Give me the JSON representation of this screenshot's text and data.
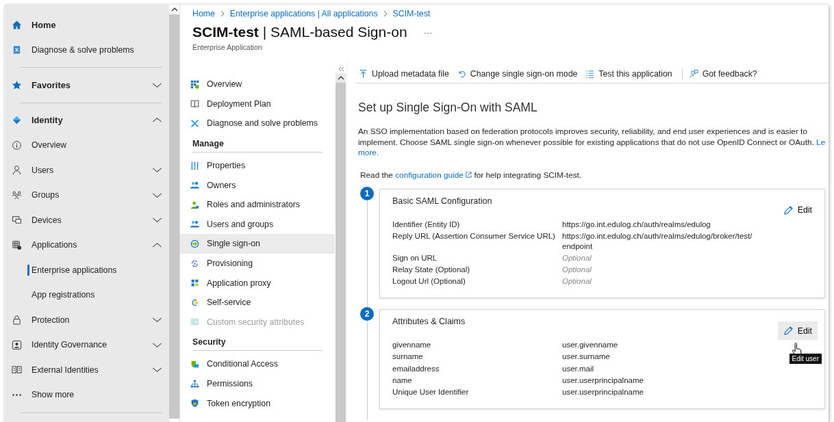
{
  "nav": {
    "groups": [
      {
        "items": [
          {
            "label": "Home",
            "kind": "heading"
          },
          {
            "label": "Diagnose & solve problems",
            "kind": "link"
          }
        ]
      },
      {
        "items": [
          {
            "label": "Favorites",
            "kind": "heading",
            "expanded": false
          }
        ]
      },
      {
        "items": [
          {
            "label": "Identity",
            "kind": "heading",
            "expanded": true
          },
          {
            "label": "Overview",
            "kind": "link"
          },
          {
            "label": "Users",
            "kind": "link",
            "expanded": false
          },
          {
            "label": "Groups",
            "kind": "link",
            "expanded": false
          },
          {
            "label": "Devices",
            "kind": "link",
            "expanded": false
          },
          {
            "label": "Applications",
            "kind": "link",
            "expanded": true,
            "children": [
              {
                "label": "Enterprise applications",
                "selected": true
              },
              {
                "label": "App registrations",
                "selected": false
              }
            ]
          },
          {
            "label": "Protection",
            "kind": "link",
            "expanded": false
          },
          {
            "label": "Identity Governance",
            "kind": "link",
            "expanded": false
          },
          {
            "label": "External Identities",
            "kind": "link",
            "expanded": false
          },
          {
            "label": "Show more",
            "kind": "link"
          }
        ]
      }
    ]
  },
  "breadcrumb": [
    "Home",
    "Enterprise applications | All applications",
    "SCIM-test"
  ],
  "title": {
    "name": "SCIM-test",
    "page": "| SAML-based Sign-on",
    "more": "···",
    "subtitle": "Enterprise Application"
  },
  "menu": {
    "sections": [
      {
        "items": [
          {
            "label": "Overview",
            "selected": false,
            "disabled": false
          },
          {
            "label": "Deployment Plan",
            "selected": false,
            "disabled": false
          },
          {
            "label": "Diagnose and solve problems",
            "selected": false,
            "disabled": false
          }
        ]
      },
      {
        "heading": "Manage",
        "items": [
          {
            "label": "Properties",
            "selected": false,
            "disabled": false
          },
          {
            "label": "Owners",
            "selected": false,
            "disabled": false
          },
          {
            "label": "Roles and administrators",
            "selected": false,
            "disabled": false
          },
          {
            "label": "Users and groups",
            "selected": false,
            "disabled": false
          },
          {
            "label": "Single sign-on",
            "selected": true,
            "disabled": false
          },
          {
            "label": "Provisioning",
            "selected": false,
            "disabled": false
          },
          {
            "label": "Application proxy",
            "selected": false,
            "disabled": false
          },
          {
            "label": "Self-service",
            "selected": false,
            "disabled": false
          },
          {
            "label": "Custom security attributes",
            "selected": false,
            "disabled": true
          }
        ]
      },
      {
        "heading": "Security",
        "items": [
          {
            "label": "Conditional Access",
            "selected": false,
            "disabled": false
          },
          {
            "label": "Permissions",
            "selected": false,
            "disabled": false
          },
          {
            "label": "Token encryption",
            "selected": false,
            "disabled": false
          }
        ]
      }
    ]
  },
  "toolbar": [
    {
      "label": "Upload metadata file"
    },
    {
      "label": "Change single sign-on mode"
    },
    {
      "label": "Test this application"
    },
    {
      "label": "Got feedback?"
    }
  ],
  "content": {
    "heading": "Set up Single Sign-On with SAML",
    "intro": "An SSO implementation based on federation protocols improves security, reliability, and end user experiences and is easier to implement. Choose SAML single sign-on whenever possible for existing applications that do not use OpenID Connect or OAuth.",
    "learn_more": [
      "Le",
      "more."
    ],
    "guide": {
      "before": "Read the",
      "link": "configuration guide",
      "after": "for help integrating SCIM-test."
    },
    "steps": [
      {
        "number": "1",
        "title": "Basic SAML Configuration",
        "edit": "Edit",
        "hovered": false,
        "rows": [
          {
            "label": "Identifier (Entity ID)",
            "value": "https://go.int.edulog.ch/auth/realms/edulog",
            "optional": false
          },
          {
            "label": "Reply URL (Assertion Consumer Service URL)",
            "value": "https://go.int.edulog.ch/auth/realms/edulog/broker/test/ endpoint",
            "optional": false
          },
          {
            "label": "Sign on URL",
            "value": "Optional",
            "optional": true
          },
          {
            "label": "Relay State (Optional)",
            "value": "Optional",
            "optional": true
          },
          {
            "label": "Logout Url (Optional)",
            "value": "Optional",
            "optional": true
          }
        ]
      },
      {
        "number": "2",
        "title": "Attributes & Claims",
        "edit": "Edit",
        "hovered": true,
        "tooltip": "Edit user",
        "rows": [
          {
            "label": "givenname",
            "value": "user.givenname",
            "optional": false
          },
          {
            "label": "surname",
            "value": "user.surname",
            "optional": false
          },
          {
            "label": "emailaddress",
            "value": "user.mail",
            "optional": false
          },
          {
            "label": "name",
            "value": "user.userprincipalname",
            "optional": false
          },
          {
            "label": "Unique User Identifier",
            "value": "user.userprincipalname",
            "optional": false
          }
        ]
      }
    ]
  }
}
